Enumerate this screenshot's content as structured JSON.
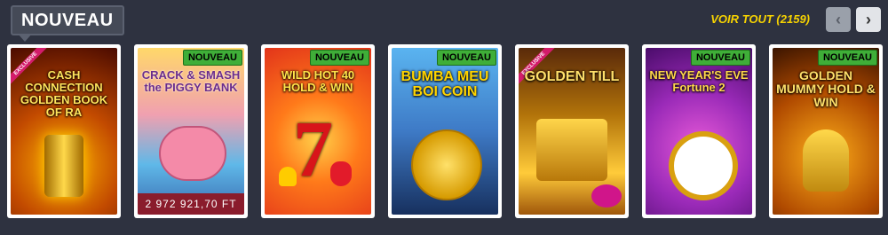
{
  "section": {
    "title": "NOUVEAU"
  },
  "header": {
    "see_all": "VOIR TOUT (2159)"
  },
  "nav": {
    "prev": "‹",
    "next": "›"
  },
  "badge_label": "NOUVEAU",
  "exclusive_label": "EXCLUSIVE",
  "games": [
    {
      "title": "CASH CONNECTION GOLDEN BOOK OF RA",
      "badge": "",
      "exclusive": true
    },
    {
      "title": "CRACK & SMASH the PIGGY BANK",
      "badge": "NOUVEAU",
      "jackpot": "2 972 921,70 FT"
    },
    {
      "title": "WILD HOT 40 HOLD & WIN",
      "badge": "NOUVEAU"
    },
    {
      "title": "BUMBA MEU BOI COIN",
      "badge": "NOUVEAU"
    },
    {
      "title": "GOLDEN TILL",
      "badge": "",
      "exclusive": true
    },
    {
      "title": "NEW YEAR'S EVE Fortune 2",
      "badge": "NOUVEAU"
    },
    {
      "title": "GOLDEN MUMMY HOLD & WIN",
      "badge": "NOUVEAU"
    }
  ],
  "colors": {
    "accent": "#f7d300",
    "badge": "#3fae38",
    "background": "#2e3240"
  }
}
